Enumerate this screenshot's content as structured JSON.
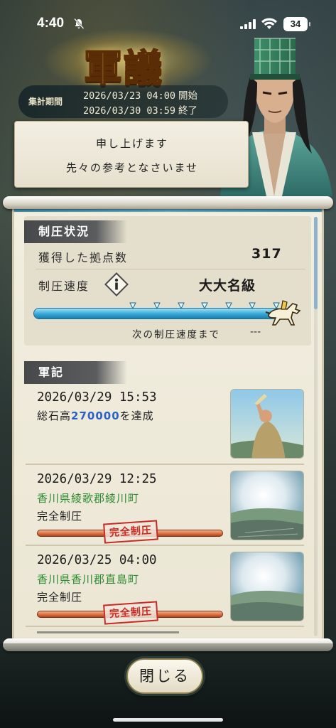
{
  "status_bar": {
    "time": "4:40",
    "battery": "34"
  },
  "header": {
    "title": "軍議",
    "period_label": "集計期間",
    "start": {
      "datetime": "2026/03/23 04:00",
      "suffix": "開始"
    },
    "end": {
      "datetime": "2026/03/30 03:59",
      "suffix": "終了"
    }
  },
  "speech": {
    "line1": "申し上げます",
    "line2": "先々の参考となさいませ"
  },
  "conquest": {
    "section_title": "制圧状況",
    "captured_label": "獲得した拠点数",
    "captured_value": "317",
    "speed_label": "制圧速度",
    "speed_value": "大大名級",
    "next_label": "次の制圧速度まで",
    "next_value": "---",
    "progress": 1.0
  },
  "records": {
    "section_title": "軍記",
    "items": [
      {
        "date": "2026/03/29 15:53",
        "text_prefix": "総石高",
        "number": "270000",
        "text_suffix": "を達成"
      },
      {
        "date": "2026/03/29 12:25",
        "location": "香川県綾歌郡綾川町",
        "status": "完全制圧",
        "stamp": "完全制圧",
        "progress": 1.0
      },
      {
        "date": "2026/03/25 04:00",
        "location": "香川県香川郡直島町",
        "status": "完全制圧",
        "stamp": "完全制圧",
        "progress": 1.0
      }
    ]
  },
  "close_button": "閉じる",
  "colors": {
    "accent_blue": "#35a7d6",
    "location_green": "#2c8a2f",
    "stamp_red": "#c62c24",
    "title_gold": "#f5cf54"
  }
}
